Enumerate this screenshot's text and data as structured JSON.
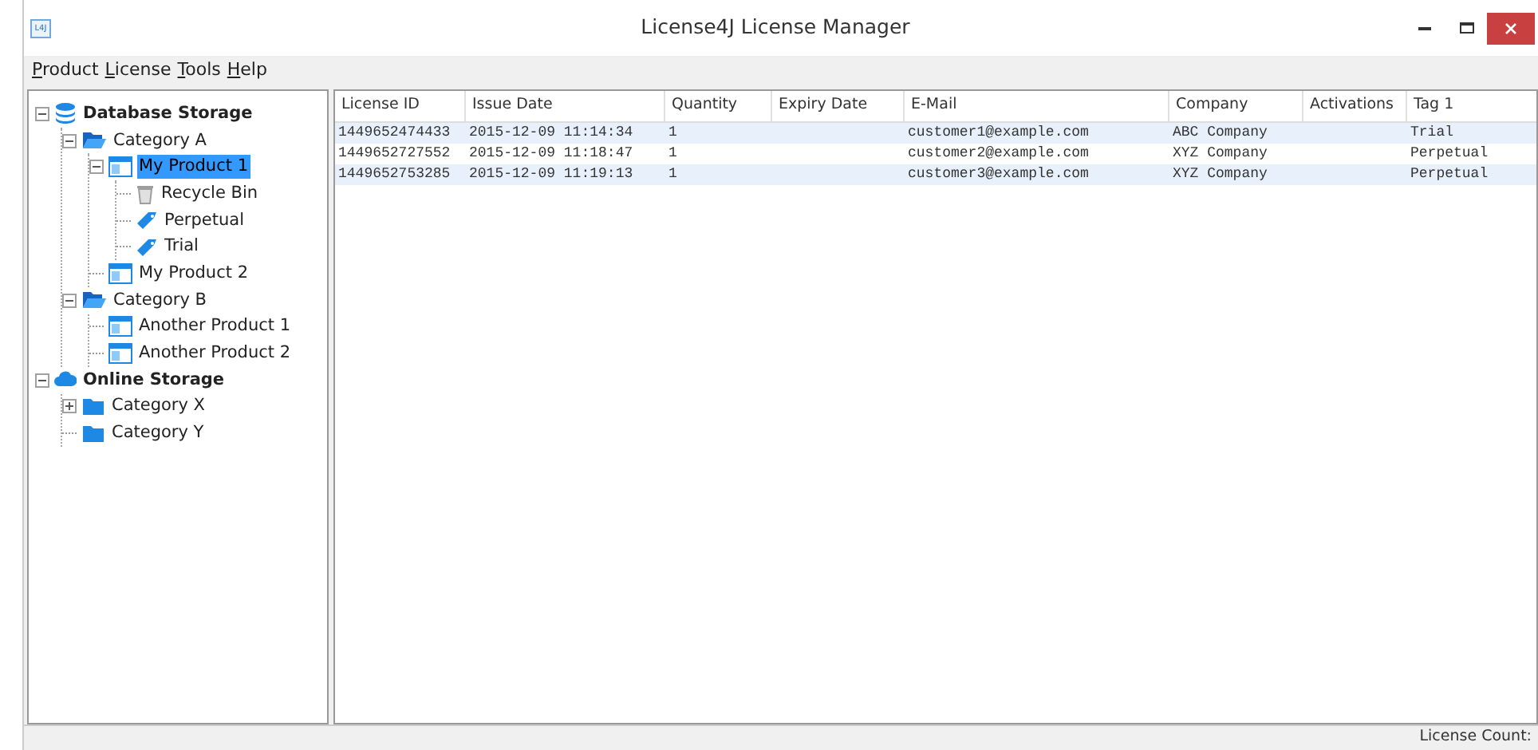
{
  "window": {
    "title": "License4J License Manager",
    "app_icon": "L4J"
  },
  "menu": [
    "Product",
    "License",
    "Tools",
    "Help"
  ],
  "tree": [
    {
      "label": "Database Storage",
      "kind": "database",
      "bold": true,
      "expanded": true,
      "selected": false,
      "children": [
        {
          "label": "Category A",
          "kind": "folder-open",
          "bold": false,
          "expanded": true,
          "selected": false,
          "children": [
            {
              "label": "My Product 1",
              "kind": "product",
              "bold": false,
              "expanded": true,
              "selected": true,
              "children": [
                {
                  "label": "Recycle Bin",
                  "kind": "recycle",
                  "bold": false,
                  "selected": false
                },
                {
                  "label": "Perpetual",
                  "kind": "tag",
                  "bold": false,
                  "selected": false
                },
                {
                  "label": "Trial",
                  "kind": "tag",
                  "bold": false,
                  "selected": false
                }
              ]
            },
            {
              "label": "My Product 2",
              "kind": "product",
              "bold": false,
              "selected": false
            }
          ]
        },
        {
          "label": "Category B",
          "kind": "folder-open",
          "bold": false,
          "expanded": true,
          "selected": false,
          "children": [
            {
              "label": "Another Product 1",
              "kind": "product",
              "bold": false,
              "selected": false
            },
            {
              "label": "Another Product 2",
              "kind": "product",
              "bold": false,
              "selected": false
            }
          ]
        }
      ]
    },
    {
      "label": "Online Storage",
      "kind": "cloud",
      "bold": true,
      "expanded": true,
      "selected": false,
      "children": [
        {
          "label": "Category X",
          "kind": "folder",
          "bold": false,
          "expanded": false,
          "selected": false
        },
        {
          "label": "Category Y",
          "kind": "folder",
          "bold": false,
          "selected": false
        }
      ]
    }
  ],
  "table": {
    "columns": [
      "License ID",
      "Issue Date",
      "Quantity",
      "Expiry Date",
      "E-Mail",
      "Company",
      "Activations",
      "Tag 1"
    ],
    "rows": [
      [
        "1449652474433",
        "2015-12-09 11:14:34",
        "1",
        "",
        "customer1@example.com",
        "ABC Company",
        "",
        "Trial"
      ],
      [
        "1449652727552",
        "2015-12-09 11:18:47",
        "1",
        "",
        "customer2@example.com",
        "XYZ Company",
        "",
        "Perpetual"
      ],
      [
        "1449652753285",
        "2015-12-09 11:19:13",
        "1",
        "",
        "customer3@example.com",
        "XYZ Company",
        "",
        "Perpetual"
      ]
    ]
  },
  "status_bar": "License Count:"
}
